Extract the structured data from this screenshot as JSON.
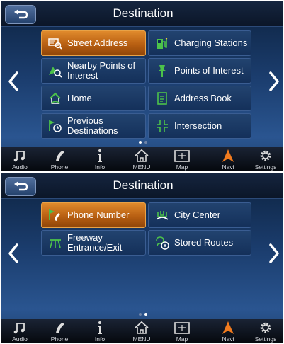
{
  "screens": [
    {
      "title": "Destination",
      "tiles": [
        {
          "label": "Street Address",
          "icon": "street-address-icon",
          "selected": true
        },
        {
          "label": "Charging Stations",
          "icon": "charging-station-icon",
          "selected": false
        },
        {
          "label": "Nearby Points of Interest",
          "icon": "nearby-poi-icon",
          "selected": false
        },
        {
          "label": "Points of Interest",
          "icon": "poi-pin-icon",
          "selected": false
        },
        {
          "label": "Home",
          "icon": "home-icon",
          "selected": false
        },
        {
          "label": "Address Book",
          "icon": "address-book-icon",
          "selected": false
        },
        {
          "label": "Previous Destinations",
          "icon": "previous-destinations-icon",
          "selected": false
        },
        {
          "label": "Intersection",
          "icon": "intersection-icon",
          "selected": false
        }
      ],
      "page_index": 1,
      "page_count": 2
    },
    {
      "title": "Destination",
      "tiles": [
        {
          "label": "Phone Number",
          "icon": "phone-number-icon",
          "selected": true
        },
        {
          "label": "City Center",
          "icon": "city-center-icon",
          "selected": false
        },
        {
          "label": "Freeway Entrance/Exit",
          "icon": "freeway-icon",
          "selected": false
        },
        {
          "label": "Stored Routes",
          "icon": "stored-routes-icon",
          "selected": false
        }
      ],
      "page_index": 2,
      "page_count": 2
    }
  ],
  "bottom_nav": [
    {
      "label": "Audio",
      "icon": "audio-icon"
    },
    {
      "label": "Phone",
      "icon": "phone-icon"
    },
    {
      "label": "Info",
      "icon": "info-icon"
    },
    {
      "label": "MENU",
      "icon": "menu-home-icon"
    },
    {
      "label": "Map",
      "icon": "map-icon"
    },
    {
      "label": "Navi",
      "icon": "navi-icon",
      "active": true
    },
    {
      "label": "Settings",
      "icon": "settings-icon"
    }
  ],
  "colors": {
    "accent_orange": "#e08a2c",
    "tile_blue": "#1a3a66",
    "background_blue": "#1b3d6e"
  }
}
